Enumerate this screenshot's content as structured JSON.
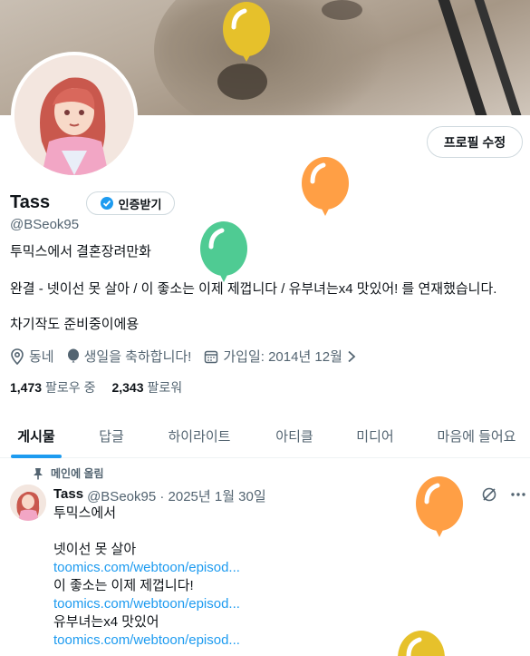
{
  "profile": {
    "name": "Tass",
    "handle": "@BSeok95",
    "verify_label": "인증받기",
    "edit_label": "프로필 수정",
    "bio_line1": "투믹스에서 결혼장려만화",
    "bio_line2": "완결 - 넷이선 못 살아 / 이 좋소는 이제 제껍니다 / 유부녀는x4 맛있어! 를 연재했습니다.",
    "bio_line3": "차기작도 준비중이에용",
    "location": "동네",
    "birthday": "생일을 축하합니다!",
    "joined": "가입일: 2014년 12월",
    "following_count": "1,473",
    "following_label": "팔로우 중",
    "followers_count": "2,343",
    "followers_label": "팔로워"
  },
  "tabs": [
    "게시물",
    "답글",
    "하이라이트",
    "아티클",
    "미디어",
    "마음에 들어요"
  ],
  "pinned_label": "메인에 올림",
  "tweet": {
    "name": "Tass",
    "meta": "@BSeok95 · 2025년 1월 30일",
    "lines": [
      "투믹스에서",
      "",
      "넷이선 못 살아",
      "toomics.com/webtoon/episod...",
      "이 좋소는 이제 제껍니다!",
      "toomics.com/webtoon/episod...",
      "유부녀는x4 맛있어",
      "toomics.com/webtoon/episod..."
    ]
  },
  "colors": {
    "accent": "#1d9bf0",
    "balloon_yellow": "#e6c12b",
    "balloon_orange": "#ff9f45",
    "balloon_green": "#4fcb93"
  },
  "icons": [
    "location-icon",
    "birthday-balloon-icon",
    "calendar-icon",
    "chevron-right-icon",
    "verified-badge-icon",
    "pin-icon",
    "grok-icon",
    "more-icon"
  ]
}
